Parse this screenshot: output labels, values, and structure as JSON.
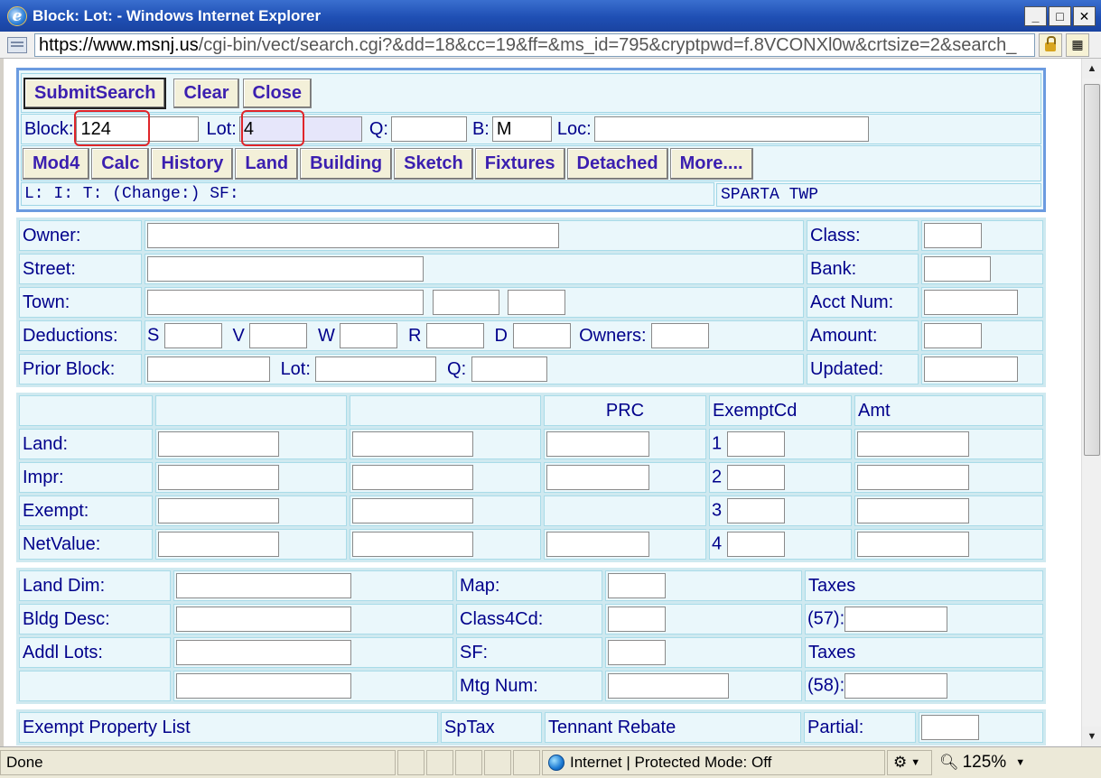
{
  "window": {
    "title": "Block: Lot: - Windows Internet Explorer",
    "min_label": "_",
    "max_label": "□",
    "close_label": "✕"
  },
  "address": {
    "url_domain": "https://www.msnj.us",
    "url_rest": "/cgi-bin/vect/search.cgi?&dd=18&cc=19&ff=&ms_id=795&cryptpwd=f.8VCONXl0w&crtsize=2&search_"
  },
  "toolbar": {
    "submit": "SubmitSearch",
    "clear": "Clear",
    "close": "Close"
  },
  "search": {
    "block_label": "Block:",
    "block_value": "124",
    "lot_label": "Lot:",
    "lot_value": "4",
    "q_label": "Q:",
    "q_value": "",
    "b_label": "B:",
    "b_value": "M",
    "loc_label": "Loc:",
    "loc_value": ""
  },
  "tabs": [
    "Mod4",
    "Calc",
    "History",
    "Land",
    "Building",
    "Sketch",
    "Fixtures",
    "Detached",
    "More...."
  ],
  "info": {
    "line": "L: I: T: (Change:) SF:",
    "town": "SPARTA TWP"
  },
  "owner_section": {
    "owner": "Owner:",
    "street": "Street:",
    "town": "Town:",
    "deductions": "Deductions:",
    "ded_s": "S",
    "ded_v": "V",
    "ded_w": "W",
    "ded_r": "R",
    "ded_d": "D",
    "owners": "Owners:",
    "prior_block": "Prior Block:",
    "lot": "Lot:",
    "q": "Q:",
    "class": "Class:",
    "bank": "Bank:",
    "acct_num": "Acct Num:",
    "amount": "Amount:",
    "updated": "Updated:"
  },
  "value_section": {
    "prc": "PRC",
    "exemptcd": "ExemptCd",
    "amt": "Amt",
    "land": "Land:",
    "impr": "Impr:",
    "exempt": "Exempt:",
    "netvalue": "NetValue:",
    "n1": "1",
    "n2": "2",
    "n3": "3",
    "n4": "4"
  },
  "land_section": {
    "land_dim": "Land Dim:",
    "bldg_desc": "Bldg Desc:",
    "addl_lots": "Addl Lots:",
    "map": "Map:",
    "class4cd": "Class4Cd:",
    "sf": "SF:",
    "mtg_num": "Mtg Num:",
    "taxes1": "Taxes",
    "taxes57": "(57):",
    "taxes2": "Taxes",
    "taxes58": "(58):"
  },
  "bottom_section": {
    "exempt_list": "Exempt Property List",
    "sptax": "SpTax",
    "tennant_rebate": "Tennant Rebate",
    "partial": "Partial:"
  },
  "status": {
    "done": "Done",
    "zone": "Internet | Protected Mode: Off",
    "zoom": "125%"
  }
}
